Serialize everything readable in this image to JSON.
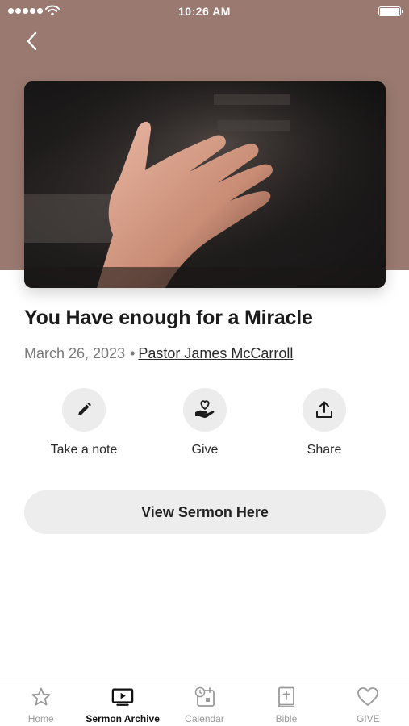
{
  "status_bar": {
    "time": "10:26 AM"
  },
  "sermon": {
    "title": "You Have enough for a Miracle",
    "date": "March 26, 2023",
    "separator": "•",
    "pastor": "Pastor James McCarroll"
  },
  "actions": {
    "note": {
      "label": "Take a note",
      "icon": "pencil-icon"
    },
    "give": {
      "label": "Give",
      "icon": "heart-hand-icon"
    },
    "share": {
      "label": "Share",
      "icon": "share-icon"
    }
  },
  "view_button": {
    "label": "View Sermon Here"
  },
  "tabs": [
    {
      "label": "Home",
      "icon": "star-icon",
      "active": false
    },
    {
      "label": "Sermon Archive",
      "icon": "tv-play-icon",
      "active": true
    },
    {
      "label": "Calendar",
      "icon": "calendar-icon",
      "active": false
    },
    {
      "label": "Bible",
      "icon": "bible-icon",
      "active": false
    },
    {
      "label": "GIVE",
      "icon": "heart-icon",
      "active": false
    }
  ],
  "colors": {
    "hero_background": "#9a7a70",
    "accent_active": "#111111",
    "inactive": "#9a9a9a"
  }
}
